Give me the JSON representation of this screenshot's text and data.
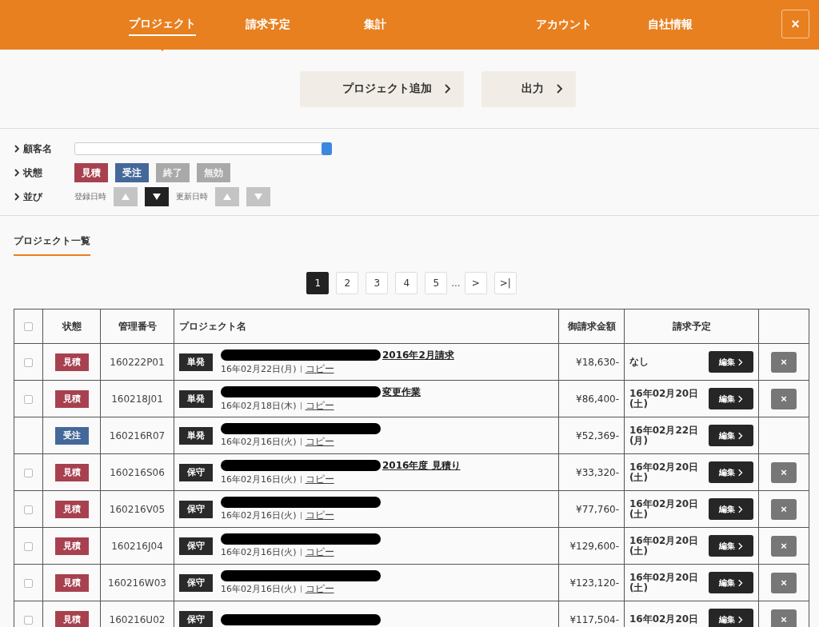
{
  "nav": {
    "tabs": [
      {
        "label": "プロジェクト",
        "selected": true
      },
      {
        "label": "請求予定",
        "selected": false
      },
      {
        "label": "集計",
        "selected": false
      },
      {
        "label": "アカウント",
        "selected": false
      },
      {
        "label": "自社情報",
        "selected": false
      }
    ],
    "close": "×"
  },
  "actions": [
    {
      "label": "プロジェクト追加"
    },
    {
      "label": "出力"
    }
  ],
  "filters": {
    "customer_label": "顧客名",
    "status_label": "状態",
    "sort_label": "並び",
    "statuses": [
      {
        "label": "見積",
        "selected": true,
        "color": "#a8414f"
      },
      {
        "label": "受注",
        "selected": true,
        "color": "#44689a"
      },
      {
        "label": "終了",
        "selected": false,
        "color": "#a9a9a9"
      },
      {
        "label": "無効",
        "selected": false,
        "color": "#a9a9a9"
      }
    ],
    "sort_groups": [
      {
        "label": "登録日時",
        "buttons": [
          {
            "kind": "up",
            "selected": false
          },
          {
            "kind": "down",
            "selected": true
          }
        ]
      },
      {
        "label": "更新日時",
        "buttons": [
          {
            "kind": "up",
            "selected": false
          },
          {
            "kind": "down",
            "selected": false
          }
        ]
      }
    ]
  },
  "section_title": "プロジェクト一覧",
  "pagination": {
    "pages": [
      {
        "label": "1",
        "selected": true
      },
      {
        "label": "2",
        "selected": false
      },
      {
        "label": "3",
        "selected": false
      },
      {
        "label": "4",
        "selected": false
      },
      {
        "label": "5",
        "selected": false
      }
    ],
    "ellipsis": "...",
    "next": ">",
    "last": ">|"
  },
  "table": {
    "columns": [
      "状態",
      "管理番号",
      "プロジェクト名",
      "御請求金額",
      "請求予定"
    ],
    "header_checked": false,
    "rows": [
      {
        "checkbox": true,
        "checked": false,
        "status": "見積",
        "color": "#a8414f",
        "number": "160222P01",
        "type": "単発",
        "name": "2016年2月請求",
        "redacted": true,
        "date": "16年02月22日(月)",
        "copy": "コピー",
        "amount": "¥18,630-",
        "billing": "なし",
        "edit": "編集",
        "deletable": true,
        "delete": "×"
      },
      {
        "checkbox": true,
        "checked": false,
        "status": "見積",
        "color": "#a8414f",
        "number": "160218J01",
        "type": "単発",
        "name": "変更作業",
        "redacted": true,
        "date": "16年02月18日(木)",
        "copy": "コピー",
        "amount": "¥86,400-",
        "billing": "16年02月20日(土)",
        "edit": "編集",
        "deletable": true,
        "delete": "×"
      },
      {
        "checkbox": false,
        "status": "受注",
        "color": "#44689a",
        "number": "160216R07",
        "type": "単発",
        "redacted": true,
        "date": "16年02月16日(火)",
        "copy": "コピー",
        "amount": "¥52,369-",
        "billing": "16年02月22日(月)",
        "edit": "編集",
        "deletable": false
      },
      {
        "checkbox": true,
        "checked": false,
        "status": "見積",
        "color": "#a8414f",
        "number": "160216S06",
        "type": "保守",
        "name": "2016年度 見積り",
        "redacted": true,
        "date": "16年02月16日(火)",
        "copy": "コピー",
        "amount": "¥33,320-",
        "billing": "16年02月20日(土)",
        "edit": "編集",
        "deletable": true,
        "delete": "×"
      },
      {
        "checkbox": true,
        "checked": false,
        "status": "見積",
        "color": "#a8414f",
        "number": "160216V05",
        "type": "保守",
        "redacted": true,
        "date": "16年02月16日(火)",
        "copy": "コピー",
        "amount": "¥77,760-",
        "billing": "16年02月20日(土)",
        "edit": "編集",
        "deletable": true,
        "delete": "×"
      },
      {
        "checkbox": true,
        "checked": false,
        "status": "見積",
        "color": "#a8414f",
        "number": "160216J04",
        "type": "保守",
        "redacted": true,
        "date": "16年02月16日(火)",
        "copy": "コピー",
        "amount": "¥129,600-",
        "billing": "16年02月20日(土)",
        "edit": "編集",
        "deletable": true,
        "delete": "×"
      },
      {
        "checkbox": true,
        "checked": false,
        "status": "見積",
        "color": "#a8414f",
        "number": "160216W03",
        "type": "保守",
        "redacted": true,
        "date": "16年02月16日(火)",
        "copy": "コピー",
        "amount": "¥123,120-",
        "billing": "16年02月20日(土)",
        "edit": "編集",
        "deletable": true,
        "delete": "×"
      },
      {
        "checkbox": true,
        "checked": false,
        "status": "見積",
        "color": "#a8414f",
        "number": "160216U02",
        "type": "保守",
        "redacted": true,
        "amount": "¥117,504-",
        "billing": "16年02月20日",
        "edit": "編集",
        "deletable": true,
        "delete": "×"
      }
    ]
  }
}
